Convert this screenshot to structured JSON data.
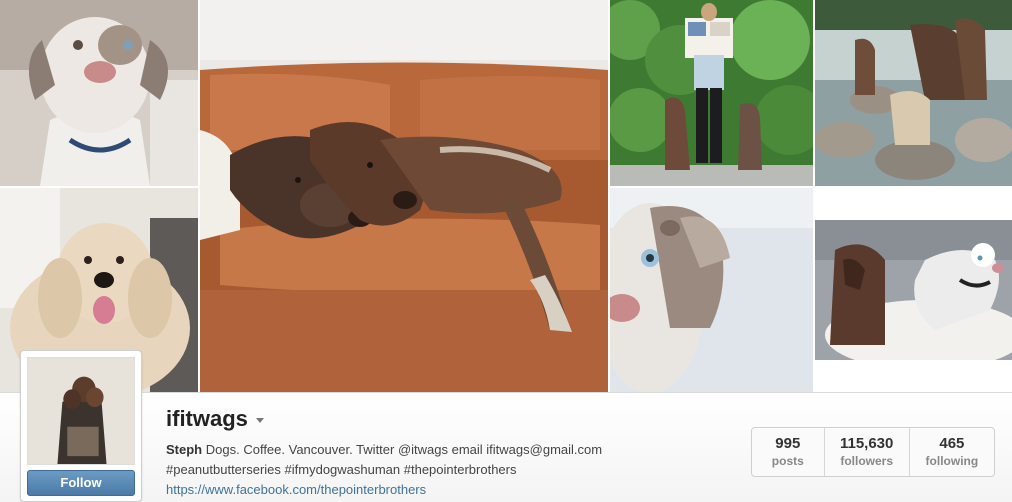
{
  "profile": {
    "username": "ifitwags",
    "full_name": "Steph",
    "bio_line1": "Dogs. Coffee. Vancouver. Twitter @itwags email ifitwags@gmail.com",
    "bio_line2": "#peanutbutterseries #ifmydogwashuman #thepointerbrothers",
    "website": "https://www.facebook.com/thepointerbrothers",
    "follow_label": "Follow",
    "menu_icon": "caret-down-icon"
  },
  "stats": [
    {
      "value": "995",
      "label": "posts"
    },
    {
      "value": "115,630",
      "label": "followers"
    },
    {
      "value": "465",
      "label": "following"
    }
  ],
  "colors": {
    "follow_button": "#4a7aa7",
    "link": "#3f729b",
    "sofa": "#b8683a"
  }
}
